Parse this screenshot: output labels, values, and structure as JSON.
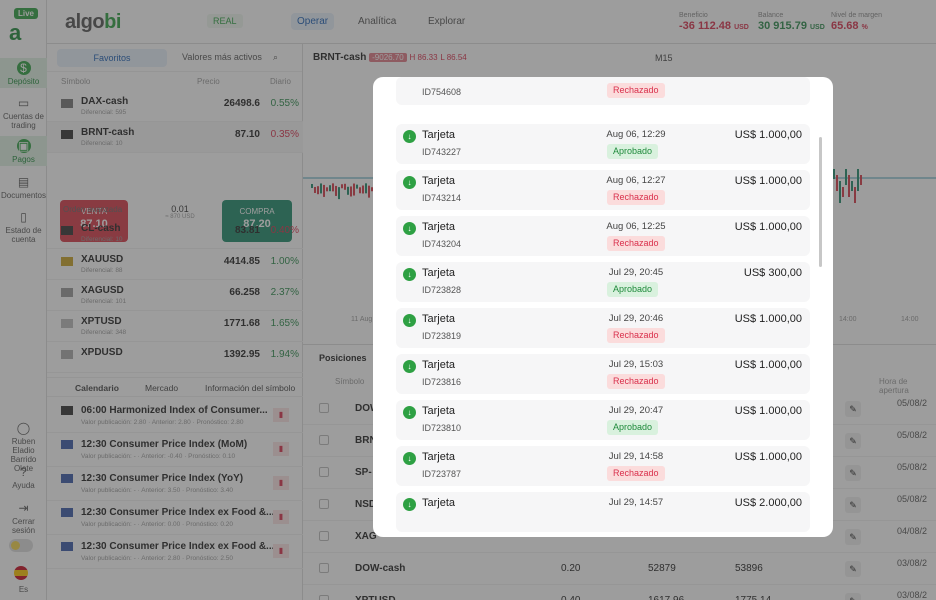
{
  "rail": {
    "live": "Live",
    "items": [
      {
        "label": "Depósito"
      },
      {
        "label": "Cuentas de trading"
      },
      {
        "label": "Pagos"
      },
      {
        "label": "Documentos"
      },
      {
        "label": "Estado de cuenta"
      }
    ],
    "user": "Ruben Eladio Barrido Olate",
    "help": "Ayuda",
    "logout": "Cerrar sesión",
    "lang": "Es"
  },
  "topbar": {
    "brand_a": "algo",
    "brand_b": "bi",
    "account": "REAL",
    "nav": [
      "Operar",
      "Analítica",
      "Explorar"
    ],
    "stats": [
      {
        "label": "Beneficio",
        "value": "-36 112.48",
        "unit": "USD"
      },
      {
        "label": "Balance",
        "value": "30 915.79",
        "unit": "USD"
      },
      {
        "label": "Nivel de margen",
        "value": "65.68",
        "unit": "%"
      }
    ]
  },
  "watchlist": {
    "tabs": [
      "Favoritos",
      "Valores más activos"
    ],
    "headers": {
      "symbol": "Símbolo",
      "price": "Precio",
      "daily": "Diario"
    },
    "rows": [
      {
        "sym": "DAX-cash",
        "sub": "Diferencial: 595",
        "price": "26498.6",
        "chg": "0.55%",
        "dir": "up"
      },
      {
        "sym": "BRNT-cash",
        "sub": "Diferencial: 10",
        "price": "87.10",
        "chg": "0.35%",
        "dir": "down"
      },
      {
        "sym": "CL-cash",
        "sub": "Diferencial: 10",
        "price": "83.81",
        "chg": "0.40%",
        "dir": "down"
      },
      {
        "sym": "XAUUSD",
        "sub": "Diferencial: 88",
        "price": "4414.85",
        "chg": "1.00%",
        "dir": "up"
      },
      {
        "sym": "XAGUSD",
        "sub": "Diferencial: 101",
        "price": "66.258",
        "chg": "2.37%",
        "dir": "up"
      },
      {
        "sym": "XPTUSD",
        "sub": "Diferencial: 348",
        "price": "1771.68",
        "chg": "1.65%",
        "dir": "up"
      },
      {
        "sym": "XPDUSD",
        "sub": "",
        "price": "1392.95",
        "chg": "1.94%",
        "dir": "up"
      }
    ],
    "trade": {
      "sell_label": "VENTA",
      "sell_price": "87.10",
      "buy_label": "COMPRA",
      "buy_price": "87.20",
      "qty": "0.01",
      "qty_sub": "≈ 870 USD"
    },
    "advanced": "Orden avanzada",
    "bottom_tabs": [
      "Calendario",
      "Mercado",
      "Información del símbolo"
    ],
    "calendar": [
      {
        "title": "06:00 Harmonized Index of Consumer...",
        "detail": "Valor publicación: 2.80 · Anterior: 2.80 · Pronóstico: 2.80"
      },
      {
        "title": "12:30 Consumer Price Index (MoM)",
        "detail": "Valor publicación: - · Anterior: -0.40 · Pronóstico: 0.10"
      },
      {
        "title": "12:30 Consumer Price Index (YoY)",
        "detail": "Valor publicación: - · Anterior: 3.50 · Pronóstico: 3.40"
      },
      {
        "title": "12:30 Consumer Price Index ex Food &...",
        "detail": "Valor publicación: - · Anterior: 0.00 · Pronóstico: 0.20"
      },
      {
        "title": "12:30 Consumer Price Index ex Food &...",
        "detail": "Valor publicación: - · Anterior: 2.80 · Pronóstico: 2.50"
      }
    ]
  },
  "chart": {
    "symbol": "BRNT-cash",
    "change": "-9026.70",
    "high": "H 86.33",
    "low": "L 86.54",
    "timeframe": "M15",
    "xlabels": [
      "11 Aug",
      "14:00",
      "14:00"
    ]
  },
  "positions": {
    "tab": "Posiciones",
    "headers": {
      "symbol": "Símbolo",
      "open_time": "Hora de apertura"
    },
    "rows": [
      {
        "sym": "DOW",
        "v1": "",
        "v2": "",
        "v3": "",
        "date": "05/08/2"
      },
      {
        "sym": "BRN",
        "v1": "",
        "v2": "",
        "v3": "",
        "date": "05/08/2"
      },
      {
        "sym": "SP-",
        "v1": "",
        "v2": "",
        "v3": "",
        "date": "05/08/2"
      },
      {
        "sym": "NSD",
        "v1": "",
        "v2": "",
        "v3": "",
        "date": "05/08/2"
      },
      {
        "sym": "XAG",
        "v1": "",
        "v2": "",
        "v3": "",
        "date": "04/08/2"
      },
      {
        "sym": "DOW-cash",
        "v1": "0.20",
        "v2": "52879",
        "v3": "53896",
        "date": "03/08/2"
      },
      {
        "sym": "XPTUSD",
        "v1": "0.40",
        "v2": "1617.96",
        "v3": "1775.14",
        "date": "03/08/2"
      }
    ]
  },
  "transactions": [
    {
      "method": "",
      "id": "ID754608",
      "date": "",
      "status": "Rechazado",
      "amount": ""
    },
    {
      "method": "Tarjeta",
      "id": "ID743227",
      "date": "Aug 06, 12:29",
      "status": "Aprobado",
      "amount": "US$ 1.000,00"
    },
    {
      "method": "Tarjeta",
      "id": "ID743214",
      "date": "Aug 06, 12:27",
      "status": "Rechazado",
      "amount": "US$ 1.000,00"
    },
    {
      "method": "Tarjeta",
      "id": "ID743204",
      "date": "Aug 06, 12:25",
      "status": "Rechazado",
      "amount": "US$ 1.000,00"
    },
    {
      "method": "Tarjeta",
      "id": "ID723828",
      "date": "Jul 29, 20:45",
      "status": "Aprobado",
      "amount": "US$ 300,00"
    },
    {
      "method": "Tarjeta",
      "id": "ID723819",
      "date": "Jul 29, 20:46",
      "status": "Rechazado",
      "amount": "US$ 1.000,00"
    },
    {
      "method": "Tarjeta",
      "id": "ID723816",
      "date": "Jul 29, 15:03",
      "status": "Rechazado",
      "amount": "US$ 1.000,00"
    },
    {
      "method": "Tarjeta",
      "id": "ID723810",
      "date": "Jul 29, 20:47",
      "status": "Aprobado",
      "amount": "US$ 1.000,00"
    },
    {
      "method": "Tarjeta",
      "id": "ID723787",
      "date": "Jul 29, 14:58",
      "status": "Rechazado",
      "amount": "US$ 1.000,00"
    },
    {
      "method": "Tarjeta",
      "id": "",
      "date": "Jul 29, 14:57",
      "status": "",
      "amount": "US$ 2.000,00"
    }
  ],
  "colors": {
    "approved": "#1f8a3b",
    "rejected": "#d9304c",
    "accent": "#2ea043"
  }
}
